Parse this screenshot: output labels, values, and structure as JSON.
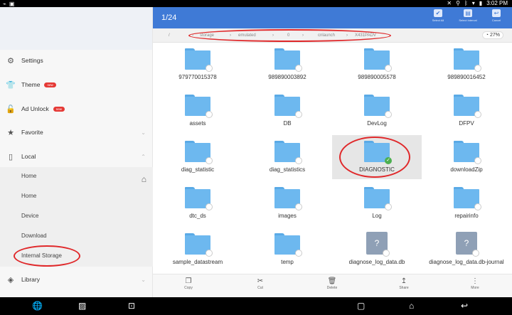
{
  "statusbar": {
    "time": "3:02 PM"
  },
  "header": {
    "count": "1/24",
    "select_all": "Select All",
    "select_interval": "Select Interval",
    "cancel": "Cancel"
  },
  "path": [
    "/",
    "storage",
    "emulated",
    "0",
    "cnlaunch",
    "X431PADV"
  ],
  "storage_usage": "27%",
  "sidebar": {
    "items": [
      {
        "label": "Settings",
        "icon": "gear-icon"
      },
      {
        "label": "Theme",
        "icon": "shirt-icon",
        "badge": "new"
      },
      {
        "label": "Ad Unlock",
        "icon": "lock-icon",
        "badge": "new"
      },
      {
        "label": "Favorite",
        "icon": "star-icon"
      },
      {
        "label": "Local",
        "icon": "phone-icon"
      },
      {
        "label": "Library",
        "icon": "layers-icon"
      }
    ],
    "local_sub": [
      "Home",
      "Home",
      "Device",
      "Download",
      "Internal Storage"
    ]
  },
  "files": [
    {
      "name": "979770015378",
      "type": "folder"
    },
    {
      "name": "989890003892",
      "type": "folder"
    },
    {
      "name": "989890005578",
      "type": "folder"
    },
    {
      "name": "989890016452",
      "type": "folder"
    },
    {
      "name": "assets",
      "type": "folder"
    },
    {
      "name": "DB",
      "type": "folder"
    },
    {
      "name": "DevLog",
      "type": "folder"
    },
    {
      "name": "DFPV",
      "type": "folder"
    },
    {
      "name": "diag_statistic",
      "type": "folder"
    },
    {
      "name": "diag_statistics",
      "type": "folder"
    },
    {
      "name": "DIAGNOSTIC",
      "type": "folder",
      "selected": true
    },
    {
      "name": "downloadZip",
      "type": "folder"
    },
    {
      "name": "dtc_ds",
      "type": "folder"
    },
    {
      "name": "images",
      "type": "folder"
    },
    {
      "name": "Log",
      "type": "folder"
    },
    {
      "name": "repairinfo",
      "type": "folder"
    },
    {
      "name": "sample_datastream",
      "type": "folder"
    },
    {
      "name": "temp",
      "type": "folder"
    },
    {
      "name": "diagnose_log_data.db",
      "type": "file"
    },
    {
      "name": "diagnose_log_data.db-journal",
      "type": "file"
    }
  ],
  "bottom_actions": [
    "Copy",
    "Cut",
    "Delete",
    "Share",
    "More"
  ],
  "accent": "#3f7ad6",
  "annotation_color": "#e0282a"
}
